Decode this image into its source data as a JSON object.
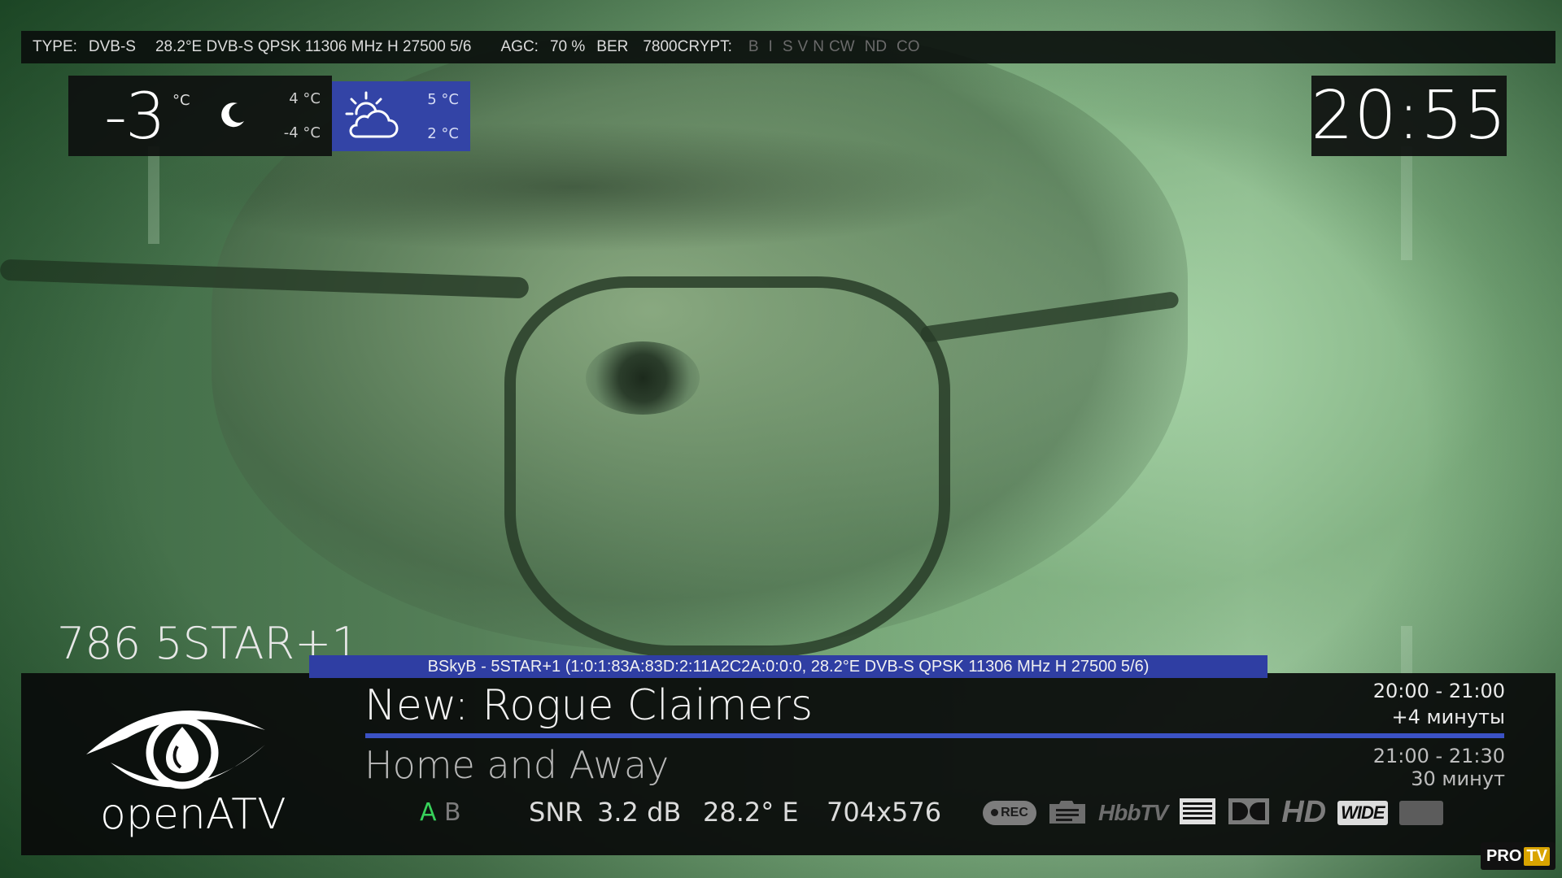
{
  "signal": {
    "type_label": "TYPE:",
    "type_value": "DVB-S",
    "transponder": "28.2°E DVB-S QPSK 11306 MHz H 27500 5/6",
    "agc_label": "AGC:",
    "agc_value": "70 %",
    "ber_label": "BER",
    "ber_value": "7800",
    "crypt_label": "CRYPT:",
    "crypt_flags": [
      "B",
      "I",
      "S",
      "V",
      "N",
      "CW",
      "ND",
      "CO"
    ]
  },
  "weather": {
    "current_temp": "-3",
    "unit": "°C",
    "today_high": "4 °C",
    "today_low": "-4 °C",
    "today_icon": "moon-icon",
    "forecast_icon": "partly-cloudy-icon",
    "forecast_high": "5 °C",
    "forecast_low": "2 °C"
  },
  "clock": "20:55",
  "channel": {
    "number_name": "786 5STAR+1"
  },
  "service_info": "BSkyB - 5STAR+1 (1:0:1:83A:83D:2:11A2C2A:0:0:0, 28.2°E DVB-S QPSK 11306 MHz H 27500 5/6)",
  "epg": {
    "now_title": "New: Rogue Claimers",
    "now_time": "20:00  -  21:00",
    "now_remaining": "+4 минуты",
    "now_progress_percent": 100,
    "next_title": "Home and Away",
    "next_time": "21:00  -  21:30",
    "next_duration": "30 минут"
  },
  "tuner": {
    "active": "A",
    "inactive": "B",
    "snr_label": "SNR",
    "snr_value": "3.2 dB",
    "orbital": "28.2° E",
    "resolution": "704x576"
  },
  "flags": {
    "rec": "REC",
    "hbbtv": "HbbTV",
    "hd": "HD",
    "wide": "WIDE"
  },
  "logo_text": "openATV",
  "watermark": {
    "pro": "PRO",
    "tv": "TV"
  },
  "colors": {
    "accent_blue": "#2f3ea3",
    "tuner_active": "#37d15a",
    "progress": "#3b52c4"
  }
}
